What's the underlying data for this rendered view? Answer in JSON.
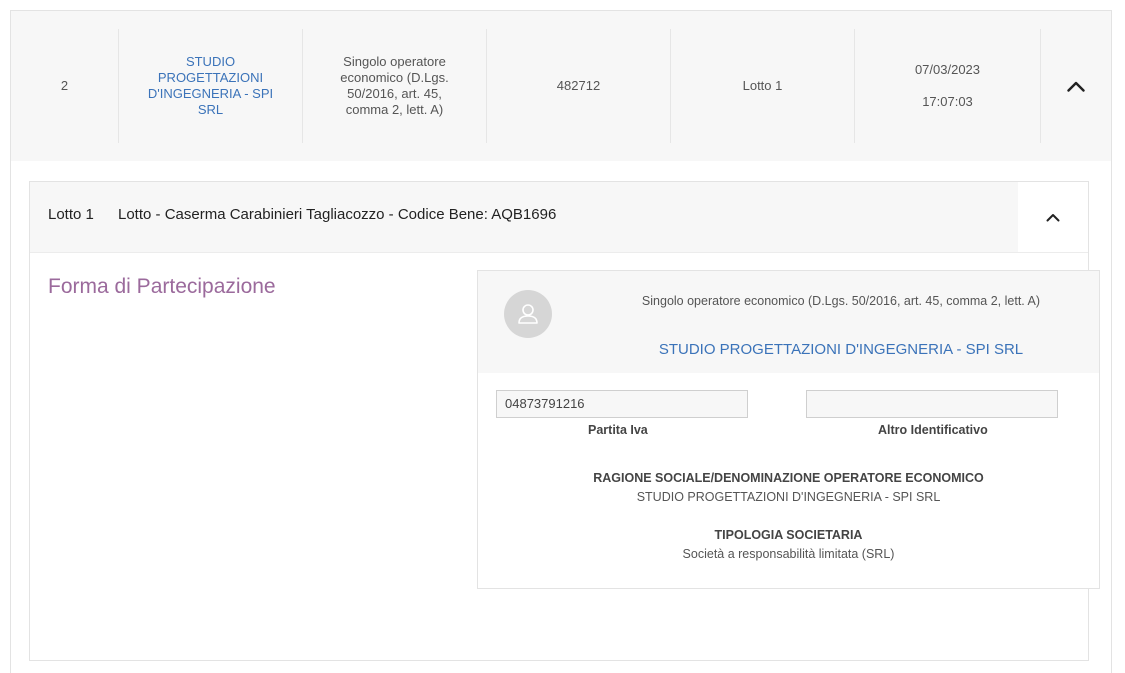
{
  "row": {
    "index": "2",
    "name": "STUDIO PROGETTAZIONI D'INGEGNERIA - SPI SRL",
    "participation_type": "Singolo operatore economico (D.Lgs. 50/2016, art. 45, comma 2, lett. A)",
    "code": "482712",
    "lot": "Lotto 1",
    "date": "07/03/2023",
    "time": "17:07:03",
    "toggle_icon": "chevron-up-icon"
  },
  "lot_panel": {
    "lot_number": "Lotto 1",
    "lot_title": "Lotto - Caserma Carabinieri Tagliacozzo - Codice Bene: AQB1696",
    "toggle_icon": "chevron-up-icon"
  },
  "section": {
    "title": "Forma di Partecipazione"
  },
  "card": {
    "avatar_icon": "user-icon",
    "participation_type": "Singolo operatore economico (D.Lgs. 50/2016, art. 45, comma 2, lett. A)",
    "operator_name": "STUDIO PROGETTAZIONI D'INGEGNERIA - SPI SRL",
    "partita_iva_value": "04873791216",
    "partita_iva_label": "Partita Iva",
    "altro_id_value": "",
    "altro_id_label": "Altro Identificativo",
    "ragione_sociale_label": "RAGIONE SOCIALE/DENOMINAZIONE OPERATORE ECONOMICO",
    "ragione_sociale_value": "STUDIO PROGETTAZIONI D'INGEGNERIA - SPI SRL",
    "tipologia_label": "TIPOLOGIA SOCIETARIA",
    "tipologia_value": "Società a responsabilità limitata (SRL)"
  },
  "colors": {
    "link": "#3b73b9",
    "section_title": "#9b6a9c",
    "row_bg": "#f7f7f7"
  }
}
